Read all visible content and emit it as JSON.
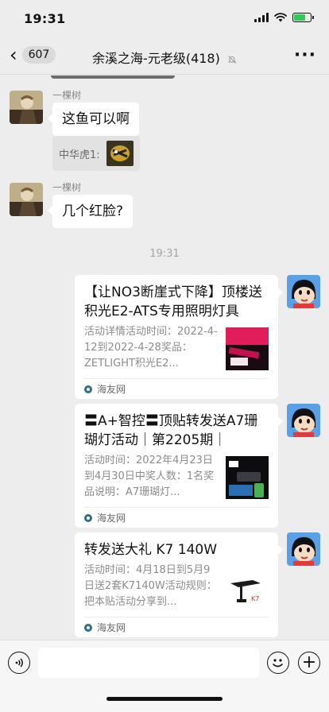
{
  "status_bar": {
    "time": "19:31",
    "battery_color": "#34c759"
  },
  "nav": {
    "back_icon": "chevron-left-icon",
    "unread_count": "607",
    "title": "余溪之海-元老级(418)",
    "mute_icon": "bell-mute-icon",
    "more_icon": "more-dots-icon"
  },
  "messages": [
    {
      "sender": "一棵树",
      "text": "这鱼可以啊",
      "quote": {
        "name": "中华虎1:"
      }
    },
    {
      "sender": "一棵树",
      "text": "几个红脸?"
    }
  ],
  "time_divider": "19:31",
  "cards": [
    {
      "title": "【让NO3断崖式下降】顶楼送积光E2-ATS专用照明灯具",
      "desc": "活动详情活动时间：2022-4-12到2022-4-28奖品：ZETLIGHT积光E2...",
      "source": "海友网"
    },
    {
      "title": "〓A+智控〓顶贴转发送A7珊瑚灯活动｜第2205期｜",
      "desc": "活动时间：2022年4月23日到4月30日中奖人数：1名奖品说明：A7珊瑚灯...",
      "source": "海友网"
    },
    {
      "title": "转发送大礼 K7 140W",
      "desc": "活动时间：4月18日到5月9日送2套K7140W活动规则：把本贴活动分享到...",
      "source": "海友网"
    }
  ],
  "input_bar": {
    "voice_icon": "voice-icon",
    "emoji_icon": "emoji-icon",
    "plus_icon": "plus-icon",
    "plus_glyph": "+"
  }
}
